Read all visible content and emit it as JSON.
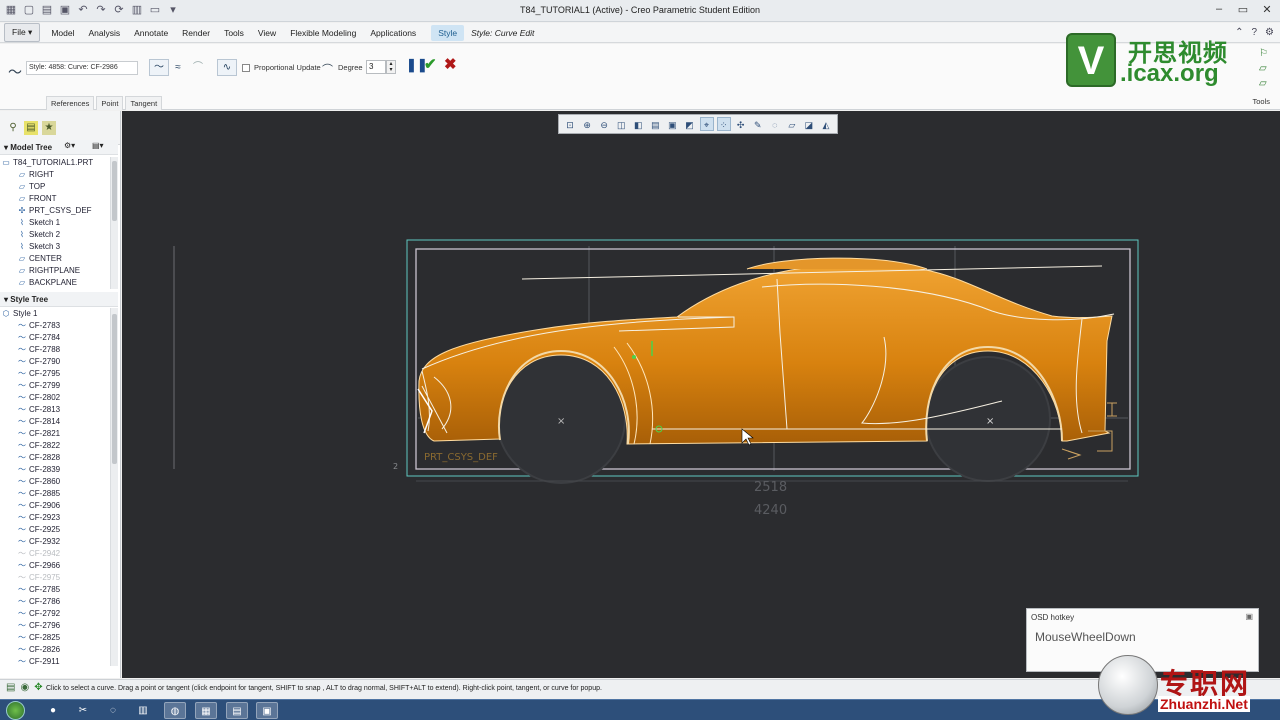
{
  "window": {
    "title": "T84_TUTORIAL1 (Active) - Creo Parametric Student Edition"
  },
  "menubar": {
    "items": [
      "File ▾",
      "Model",
      "Analysis",
      "Annotate",
      "Render",
      "Tools",
      "View",
      "Flexible Modeling",
      "Applications"
    ],
    "active_tab": "Style",
    "contextual_tab": "Style: Curve Edit"
  },
  "ribbon": {
    "curve_field_value": "Style: 4858: Curve: CF-2986",
    "proportional_update_label": "Proportional Update",
    "proportional_update_checked": false,
    "degree_label": "Degree",
    "degree_value": "3",
    "subtabs": [
      "References",
      "Point",
      "Tangent"
    ],
    "tools_label": "Tools"
  },
  "watermark_logo": {
    "letter": "V",
    "chinese": "开思视频",
    "url": ".icax.org"
  },
  "model_tree": {
    "header": "Model Tree",
    "items": [
      {
        "icon": "part-icon",
        "glyph": "▭",
        "label": "T84_TUTORIAL1.PRT"
      },
      {
        "icon": "datum-plane-icon",
        "glyph": "▱",
        "label": "RIGHT"
      },
      {
        "icon": "datum-plane-icon",
        "glyph": "▱",
        "label": "TOP"
      },
      {
        "icon": "datum-plane-icon",
        "glyph": "▱",
        "label": "FRONT"
      },
      {
        "icon": "csys-icon",
        "glyph": "✣",
        "label": "PRT_CSYS_DEF"
      },
      {
        "icon": "sketch-icon",
        "glyph": "⌇",
        "label": "Sketch 1"
      },
      {
        "icon": "sketch-icon",
        "glyph": "⌇",
        "label": "Sketch 2"
      },
      {
        "icon": "sketch-icon",
        "glyph": "⌇",
        "label": "Sketch 3"
      },
      {
        "icon": "datum-plane-icon",
        "glyph": "▱",
        "label": "CENTER"
      },
      {
        "icon": "datum-plane-icon",
        "glyph": "▱",
        "label": "RIGHTPLANE"
      },
      {
        "icon": "datum-plane-icon",
        "glyph": "▱",
        "label": "BACKPLANE"
      }
    ]
  },
  "style_tree": {
    "header": "Style Tree",
    "root": "Style 1",
    "items": [
      {
        "label": "CF-2783",
        "dim": false
      },
      {
        "label": "CF-2784",
        "dim": false
      },
      {
        "label": "CF-2788",
        "dim": false
      },
      {
        "label": "CF-2790",
        "dim": false
      },
      {
        "label": "CF-2795",
        "dim": false
      },
      {
        "label": "CF-2799",
        "dim": false
      },
      {
        "label": "CF-2802",
        "dim": false
      },
      {
        "label": "CF-2813",
        "dim": false
      },
      {
        "label": "CF-2814",
        "dim": false
      },
      {
        "label": "CF-2821",
        "dim": false
      },
      {
        "label": "CF-2822",
        "dim": false
      },
      {
        "label": "CF-2828",
        "dim": false
      },
      {
        "label": "CF-2839",
        "dim": false
      },
      {
        "label": "CF-2860",
        "dim": false
      },
      {
        "label": "CF-2885",
        "dim": false
      },
      {
        "label": "CF-2906",
        "dim": false
      },
      {
        "label": "CF-2923",
        "dim": false
      },
      {
        "label": "CF-2925",
        "dim": false
      },
      {
        "label": "CF-2932",
        "dim": false
      },
      {
        "label": "CF-2942",
        "dim": true
      },
      {
        "label": "CF-2966",
        "dim": false
      },
      {
        "label": "CF-2975",
        "dim": true
      },
      {
        "label": "CF-2785",
        "dim": false
      },
      {
        "label": "CF-2786",
        "dim": false
      },
      {
        "label": "CF-2792",
        "dim": false
      },
      {
        "label": "CF-2796",
        "dim": false
      },
      {
        "label": "CF-2825",
        "dim": false
      },
      {
        "label": "CF-2826",
        "dim": false
      },
      {
        "label": "CF-2911",
        "dim": false
      }
    ]
  },
  "graphics": {
    "csys_label": "PRT_CSYS_DEF",
    "dimension_1": "2518",
    "dimension_2": "4240",
    "side_mark": "2",
    "colors": {
      "background": "#2b2c2f",
      "body": "#d8820f",
      "body_highlight": "#f0a332",
      "frame": "#5fc8c0",
      "curves": "#f6f0e2"
    }
  },
  "osd": {
    "title": "OSD hotkey",
    "hotkey": "MouseWheelDown"
  },
  "statusbar": {
    "message": "Click to select a curve.  Drag a point or tangent (click endpoint for tangent, SHIFT to snap , ALT to drag normal, SHIFT+ALT to extend). Right-click point, tangent, or curve for popup."
  },
  "zhuanzhi_watermark": {
    "chinese": "专职网",
    "url": "Zhuanzhi.Net"
  }
}
